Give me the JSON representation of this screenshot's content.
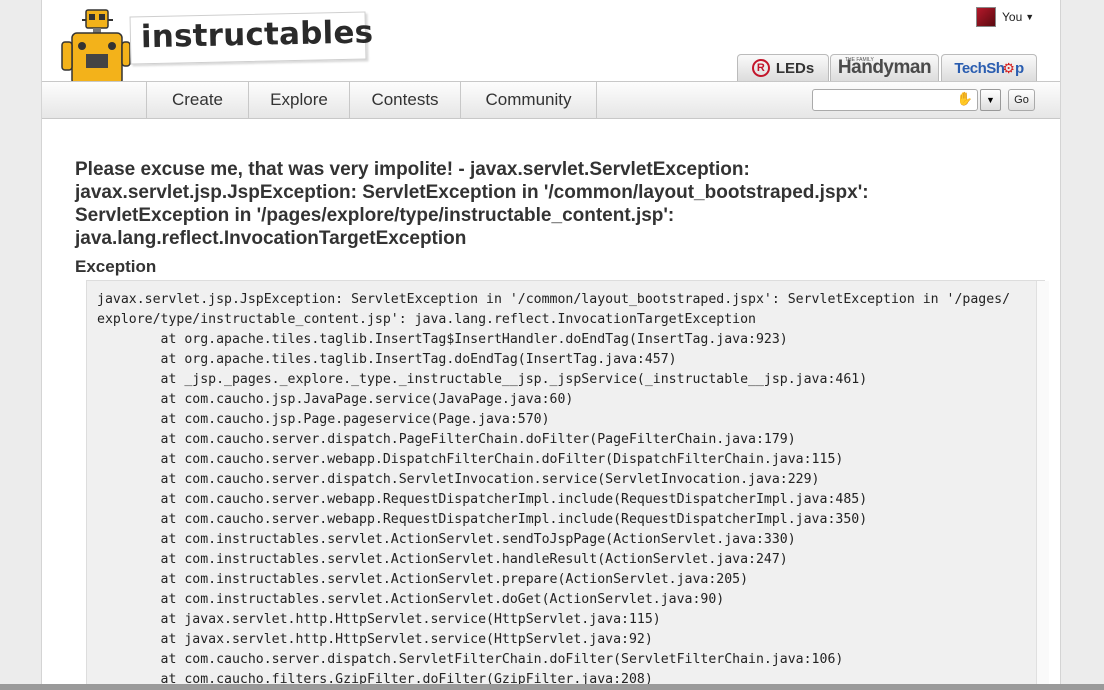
{
  "header": {
    "logo_text": "instructables",
    "user": {
      "label": "You"
    },
    "partner_tabs": {
      "leds": {
        "badge": "R",
        "label": "LEDs"
      },
      "handyman": {
        "small": "THE FAMILY",
        "label": "Handyman"
      },
      "techshop": {
        "label": "TechSh",
        "gear": "⚙",
        "suffix": "p"
      }
    }
  },
  "nav": {
    "items": [
      {
        "label": "Create"
      },
      {
        "label": "Explore"
      },
      {
        "label": "Contests"
      },
      {
        "label": "Community"
      }
    ],
    "search": {
      "value": "",
      "placeholder": ""
    },
    "go_label": "Go"
  },
  "content": {
    "title": "Please excuse me, that was very impolite! - javax.servlet.ServletException: javax.servlet.jsp.JspException: ServletException in '/common/layout_bootstraped.jspx': ServletException in '/pages/explore/type/instructable_content.jsp': java.lang.reflect.InvocationTargetException",
    "exception_heading": "Exception",
    "stack_lines": [
      "javax.servlet.jsp.JspException: ServletException in '/common/layout_bootstraped.jspx': ServletException in '/pages/",
      "explore/type/instructable_content.jsp': java.lang.reflect.InvocationTargetException",
      "\tat org.apache.tiles.taglib.InsertTag$InsertHandler.doEndTag(InsertTag.java:923)",
      "\tat org.apache.tiles.taglib.InsertTag.doEndTag(InsertTag.java:457)",
      "\tat _jsp._pages._explore._type._instructable__jsp._jspService(_instructable__jsp.java:461)",
      "\tat com.caucho.jsp.JavaPage.service(JavaPage.java:60)",
      "\tat com.caucho.jsp.Page.pageservice(Page.java:570)",
      "\tat com.caucho.server.dispatch.PageFilterChain.doFilter(PageFilterChain.java:179)",
      "\tat com.caucho.server.webapp.DispatchFilterChain.doFilter(DispatchFilterChain.java:115)",
      "\tat com.caucho.server.dispatch.ServletInvocation.service(ServletInvocation.java:229)",
      "\tat com.caucho.server.webapp.RequestDispatcherImpl.include(RequestDispatcherImpl.java:485)",
      "\tat com.caucho.server.webapp.RequestDispatcherImpl.include(RequestDispatcherImpl.java:350)",
      "\tat com.instructables.servlet.ActionServlet.sendToJspPage(ActionServlet.java:330)",
      "\tat com.instructables.servlet.ActionServlet.handleResult(ActionServlet.java:247)",
      "\tat com.instructables.servlet.ActionServlet.prepare(ActionServlet.java:205)",
      "\tat com.instructables.servlet.ActionServlet.doGet(ActionServlet.java:90)",
      "\tat javax.servlet.http.HttpServlet.service(HttpServlet.java:115)",
      "\tat javax.servlet.http.HttpServlet.service(HttpServlet.java:92)",
      "\tat com.caucho.server.dispatch.ServletFilterChain.doFilter(ServletFilterChain.java:106)",
      "\tat com.caucho.filters.GzipFilter.doFilter(GzipFilter.java:208)"
    ]
  }
}
